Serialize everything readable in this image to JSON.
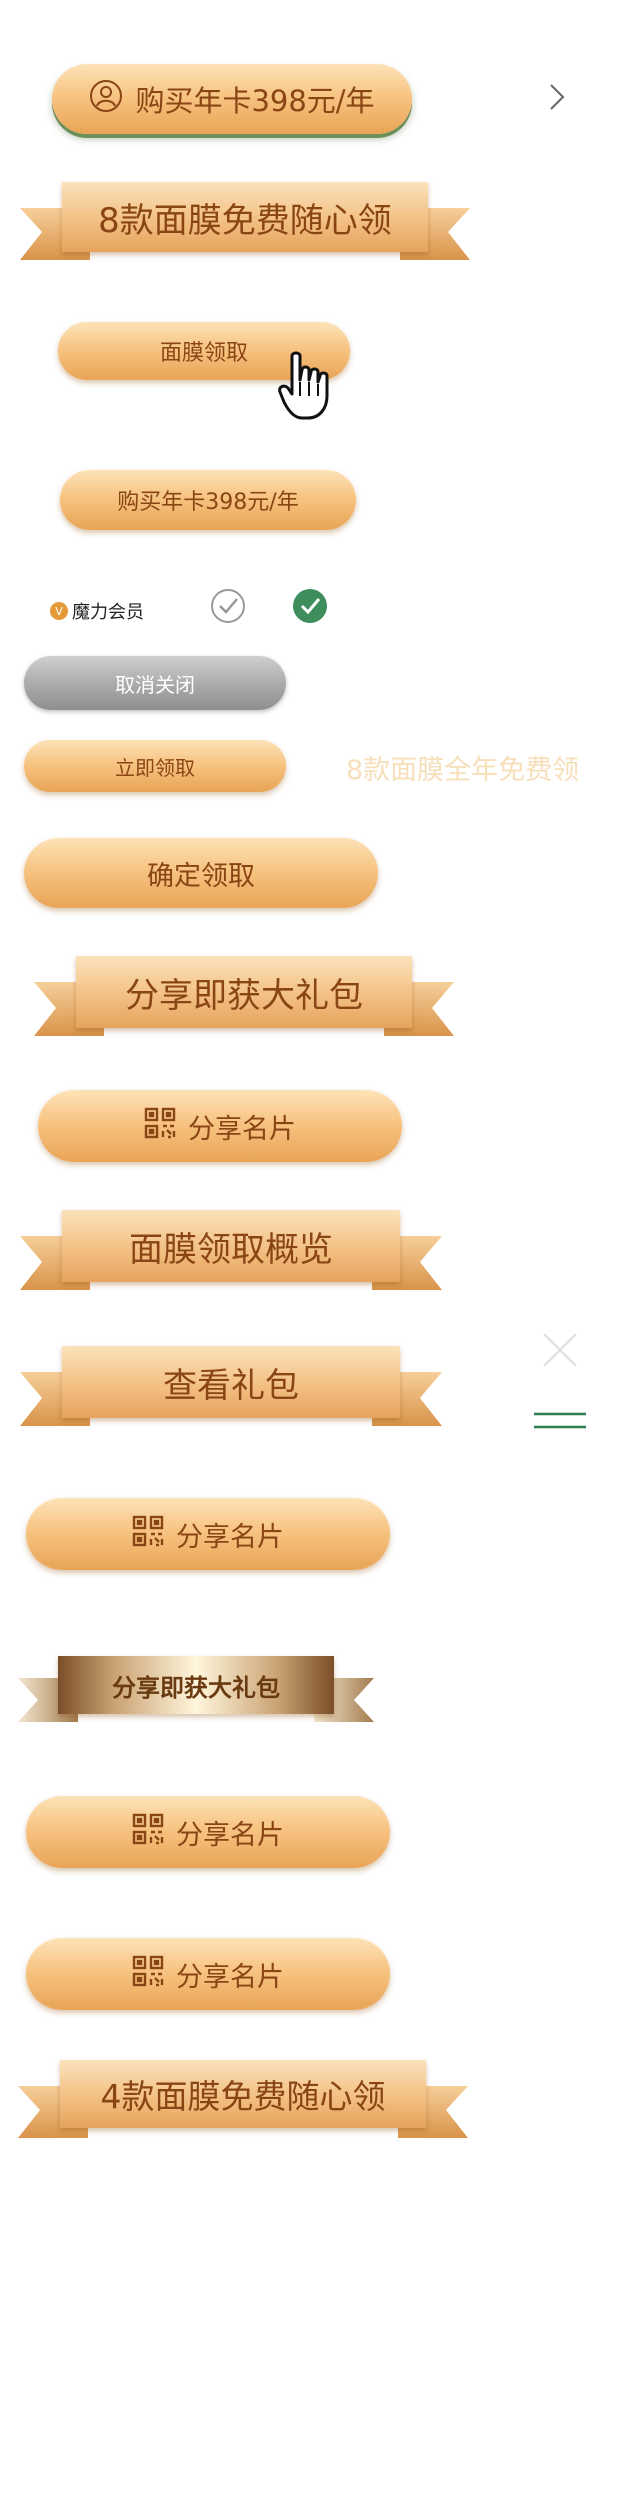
{
  "buy_card_button": {
    "label": "购买年卡398元/年",
    "icon": "user-circle-icon"
  },
  "chevron": {
    "icon": "chevron-right-icon"
  },
  "ribbon_free_masks_8": {
    "label": "8款面膜免费随心领"
  },
  "mask_claim_button": {
    "label": "面膜领取",
    "cursor": "hand-pointer-icon"
  },
  "buy_card_button_small": {
    "label": "购买年卡398元/年"
  },
  "member_tag": {
    "label": "魔力会员",
    "badge": "V"
  },
  "check_outline": {
    "icon": "check-outline-icon"
  },
  "check_filled": {
    "icon": "check-filled-icon",
    "color": "#3e8e5d"
  },
  "cancel_close_button": {
    "label": "取消关闭"
  },
  "claim_now_button": {
    "label": "立即领取"
  },
  "faded_text": {
    "label": "8款面膜全年免费领"
  },
  "confirm_claim_button": {
    "label": "确定领取"
  },
  "ribbon_share_gift_1": {
    "label": "分享即获大礼包"
  },
  "share_card_button_1": {
    "label": "分享名片",
    "icon": "qr-code-icon"
  },
  "ribbon_mask_overview": {
    "label": "面膜领取概览"
  },
  "close_icon": {
    "icon": "close-icon"
  },
  "ribbon_view_gift": {
    "label": "查看礼包"
  },
  "menu_icon": {
    "icon": "menu-icon",
    "color": "#2e7d4f"
  },
  "share_card_button_2": {
    "label": "分享名片",
    "icon": "qr-code-icon"
  },
  "ribbon_share_gift_dark": {
    "label": "分享即获大礼包"
  },
  "share_card_button_3": {
    "label": "分享名片",
    "icon": "qr-code-icon"
  },
  "share_card_button_4": {
    "label": "分享名片",
    "icon": "qr-code-icon"
  },
  "ribbon_free_masks_4": {
    "label": "4款面膜免费随心领"
  },
  "colors": {
    "accent_text": "#8a4515",
    "gold_light": "#fde3b8",
    "gold_dark": "#e9a456",
    "green": "#3e8e5d"
  }
}
